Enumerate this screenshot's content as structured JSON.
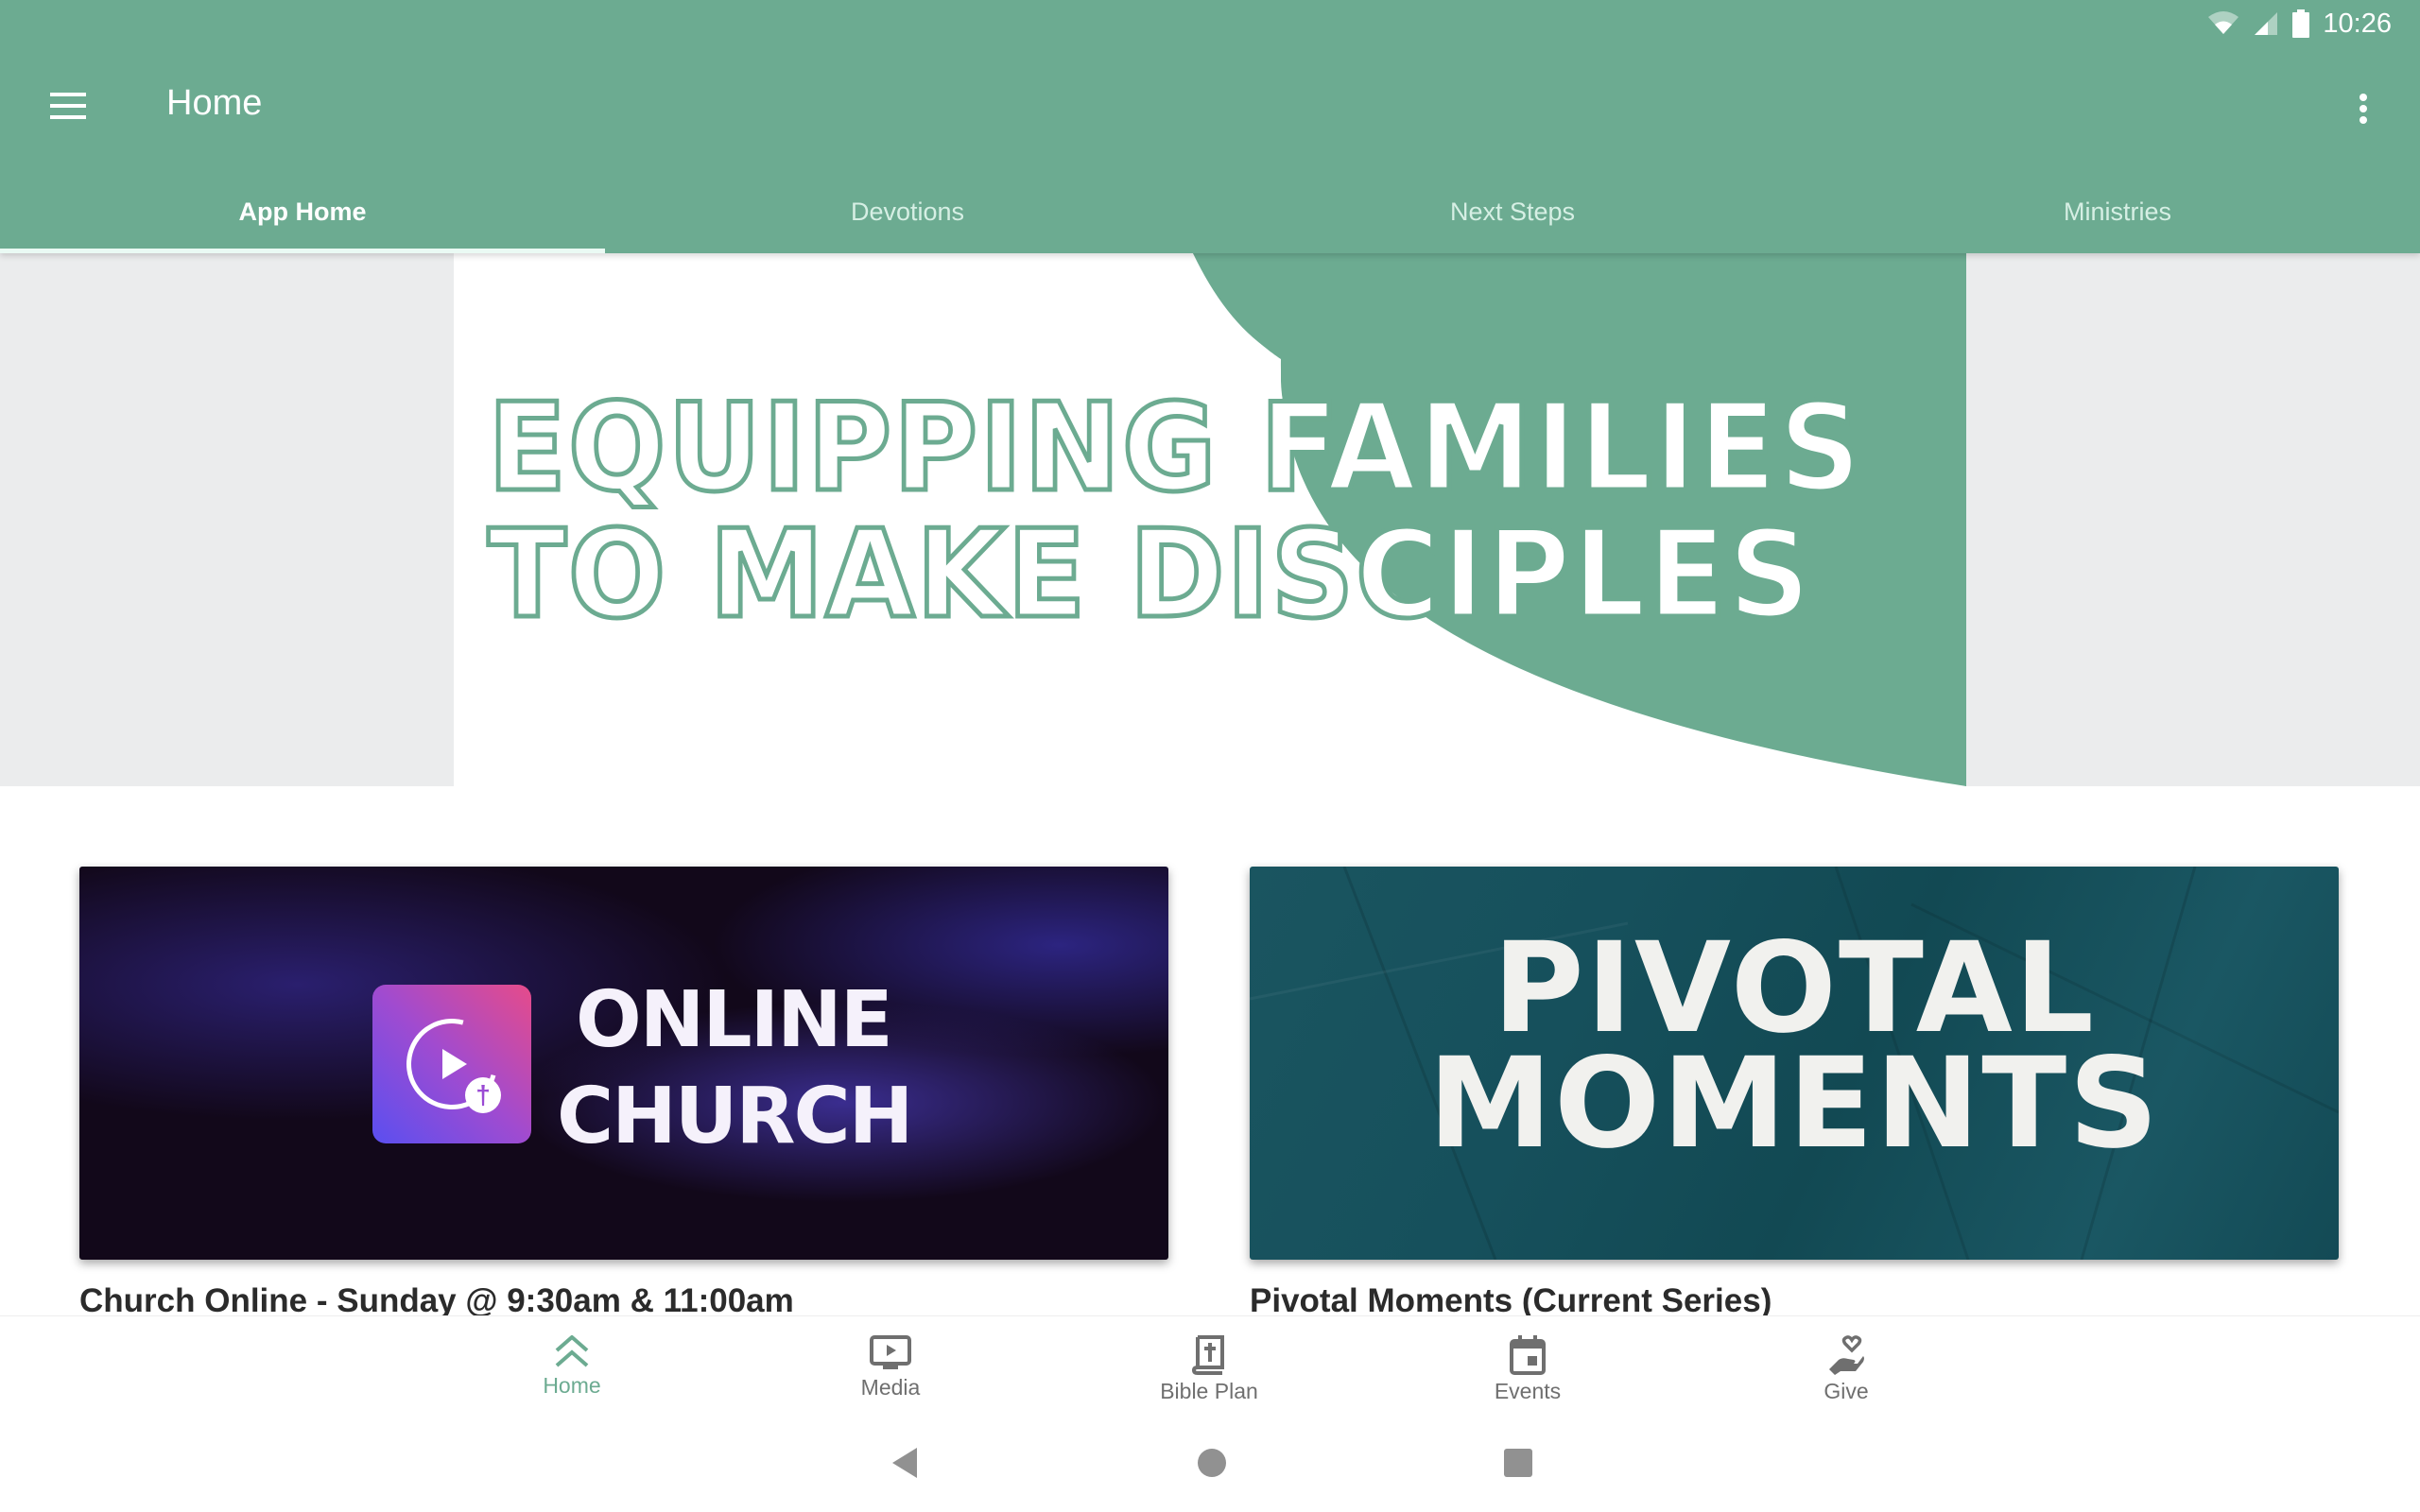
{
  "status_bar": {
    "time": "10:26",
    "icons": [
      "wifi-icon",
      "cell-signal-icon",
      "battery-icon"
    ]
  },
  "toolbar": {
    "title": "Home",
    "menu_icon": "hamburger-menu-icon",
    "overflow_icon": "more-vert-icon"
  },
  "tabs": [
    {
      "label": "App Home",
      "active": true
    },
    {
      "label": "Devotions",
      "active": false
    },
    {
      "label": "Next Steps",
      "active": false
    },
    {
      "label": "Ministries",
      "active": false
    }
  ],
  "banner": {
    "line1": "EQUIPPING FAMILIES",
    "line2": "TO MAKE DISCIPLES"
  },
  "cards": [
    {
      "image_text": [
        "ONLINE",
        "CHURCH"
      ],
      "title": "Church Online - Sunday @ 9:30am & 11:00am"
    },
    {
      "image_text": [
        "PIVOTAL",
        "MOMENTS"
      ],
      "title": "Pivotal Moments (Current Series)"
    }
  ],
  "bottom_nav": [
    {
      "label": "Home",
      "icon": "double-chevron-up-icon",
      "active": true
    },
    {
      "label": "Media",
      "icon": "tv-play-icon",
      "active": false
    },
    {
      "label": "Bible Plan",
      "icon": "bible-icon",
      "active": false
    },
    {
      "label": "Events",
      "icon": "calendar-icon",
      "active": false
    },
    {
      "label": "Give",
      "icon": "hand-heart-icon",
      "active": false
    }
  ],
  "system_nav": [
    "back",
    "home",
    "recents"
  ],
  "colors": {
    "brand": "#6cab91",
    "tab_inactive": "#d6efe4",
    "nav_inactive": "#6f6f6f"
  }
}
